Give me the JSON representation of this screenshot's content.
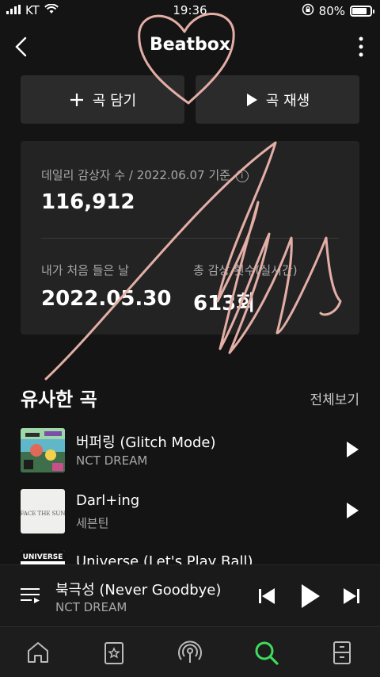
{
  "status_bar": {
    "carrier": "KT",
    "time": "19:36",
    "battery": "80%",
    "battery_level": 0.8
  },
  "header": {
    "title": "Beatbox"
  },
  "actions": {
    "add_label": "곡 담기",
    "play_label": "곡 재생"
  },
  "stats": {
    "daily_listeners_label": "데일리 감상자 수 / 2022.06.07 기준",
    "daily_listeners_value": "116,912",
    "first_listen_label": "내가 처음 들은 날",
    "first_listen_value": "2022.05.30",
    "total_plays_label": "총 감상 횟수(실시간)",
    "total_plays_value": "613회"
  },
  "similar": {
    "title": "유사한 곡",
    "see_all": "전체보기",
    "tracks": [
      {
        "title": "버퍼링 (Glitch Mode)",
        "artist": "NCT DREAM"
      },
      {
        "title": "Darl+ing",
        "artist": "세븐틴"
      },
      {
        "title": "Universe (Let's Play Ball)",
        "artist": ""
      }
    ],
    "art_text": {
      "track2": "FACE THE SUN",
      "track3": "UNIVERSE"
    }
  },
  "now_playing": {
    "title": "북극성 (Never Goodbye)",
    "artist": "NCT DREAM"
  },
  "tabs": [
    "home",
    "library",
    "podcast",
    "search",
    "storage"
  ],
  "colors": {
    "accent": "#3ddc5c",
    "card": "#232323",
    "button": "#2b2b2b",
    "drawing": "#e3aea6"
  }
}
